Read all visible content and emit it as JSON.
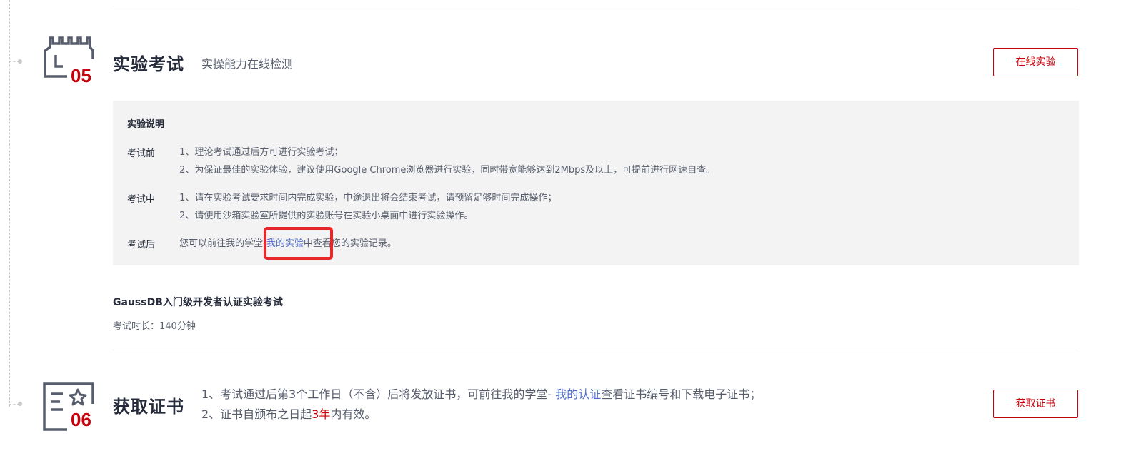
{
  "step05": {
    "number": "05",
    "icon": "lab-flask-icon",
    "title": "实验考试",
    "subtitle": "实操能力在线检测",
    "button_label": "在线实验"
  },
  "notice": {
    "title": "实验说明",
    "before": {
      "label": "考试前",
      "lines": [
        "1、理论考试通过后方可进行实验考试；",
        "2、为保证最佳的实验体验，建议使用Google Chrome浏览器进行实验，同时带宽能够达到2Mbps及以上，可提前进行网速自查。"
      ]
    },
    "during": {
      "label": "考试中",
      "lines": [
        "1、请在实验考试要求时间内完成实验，中途退出将会结束考试，请预留足够时间完成操作；",
        "2、请使用沙箱实验室所提供的实验账号在实验小桌面中进行实验操作。"
      ]
    },
    "after": {
      "label": "考试后",
      "text_before": "您可以前往我的学堂-",
      "link": "我的实验",
      "text_after": "中查看您的实验记录。"
    }
  },
  "exam": {
    "name": "GaussDB入门级开发者认证实验考试",
    "duration": "考试时长：140分钟"
  },
  "step06": {
    "number": "06",
    "icon": "certificate-icon",
    "title": "获取证书",
    "line1_before": "1、考试通过后第3个工作日（不含）后将发放证书，可前往我的学堂- ",
    "line1_link": "我的认证",
    "line1_after": "查看证书编号和下载电子证书；",
    "line2_before": "2、证书自颁布之日起",
    "line2_highlight": "3年",
    "line2_after": "内有效。",
    "button_label": "获取证书"
  },
  "colors": {
    "accent_red": "#c7000b",
    "link_blue": "#526ecc",
    "highlight_box": "#e8272b",
    "icon_gray": "#575d6c"
  }
}
